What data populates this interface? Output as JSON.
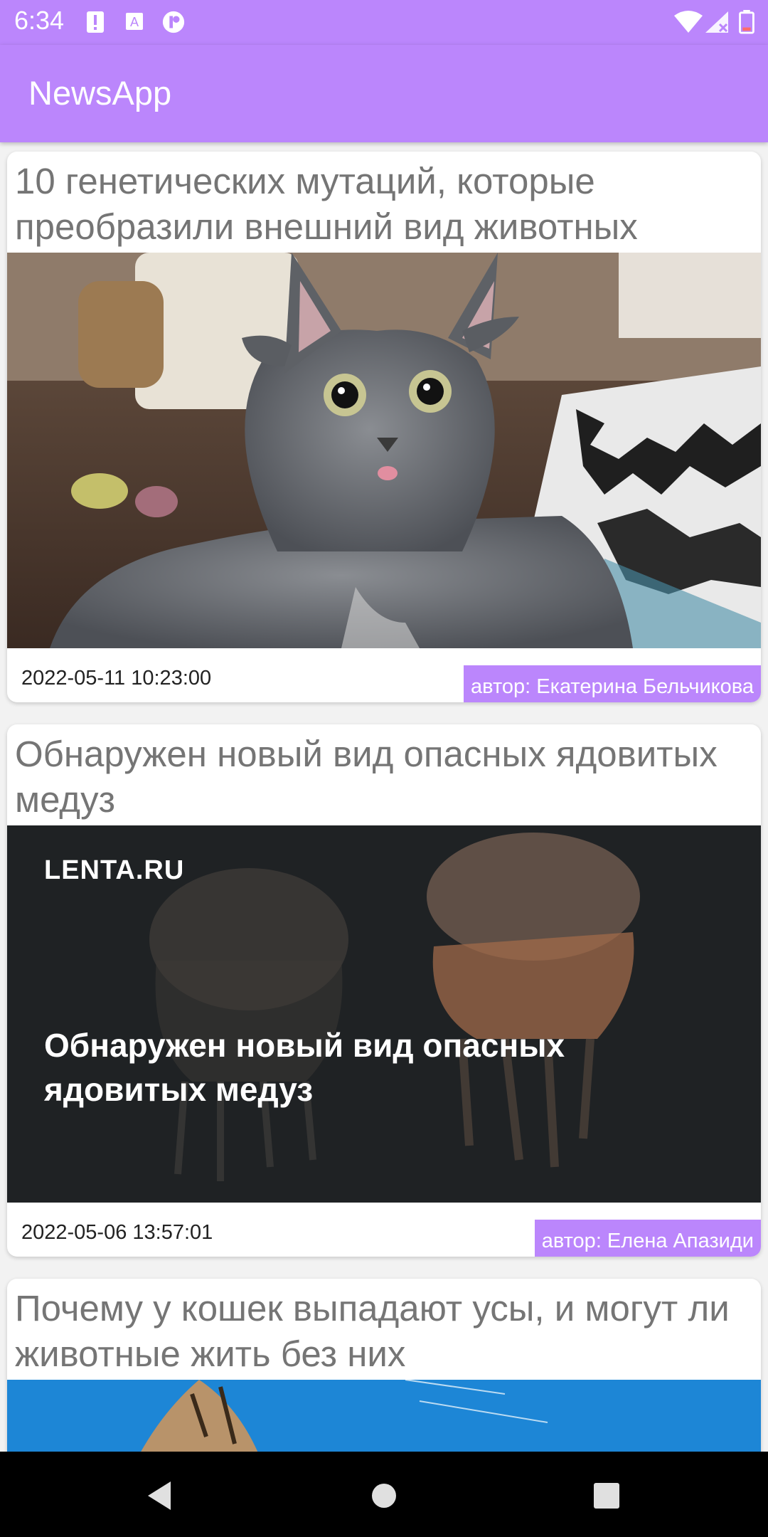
{
  "status_bar": {
    "time": "6:34",
    "icons": [
      "alert-icon",
      "font-a-icon",
      "app-notification-icon",
      "wifi-icon",
      "signal-icon",
      "battery-icon"
    ]
  },
  "app_bar": {
    "title": "NewsApp"
  },
  "colors": {
    "accent": "#bb86fc",
    "card_bg": "#ffffff",
    "title_text": "#757575"
  },
  "articles": [
    {
      "title": "10 генетических мутаций, которые преобразили внешний вид животных",
      "date": "2022-05-11 10:23:00",
      "author": "автор: Екатерина Бельчикова"
    },
    {
      "title": "Обнаружен новый вид опасных ядовитых медуз",
      "date": "2022-05-06 13:57:01",
      "author": "автор: Елена Апазиди",
      "image_brand": "LENTA.RU",
      "image_headline": "Обнаружен новый вид опасных ядовитых медуз"
    },
    {
      "title": "Почему у кошек выпадают усы, и могут ли животные жить без них"
    }
  ],
  "nav": {
    "buttons": [
      "back-icon",
      "home-icon",
      "recents-icon"
    ]
  }
}
